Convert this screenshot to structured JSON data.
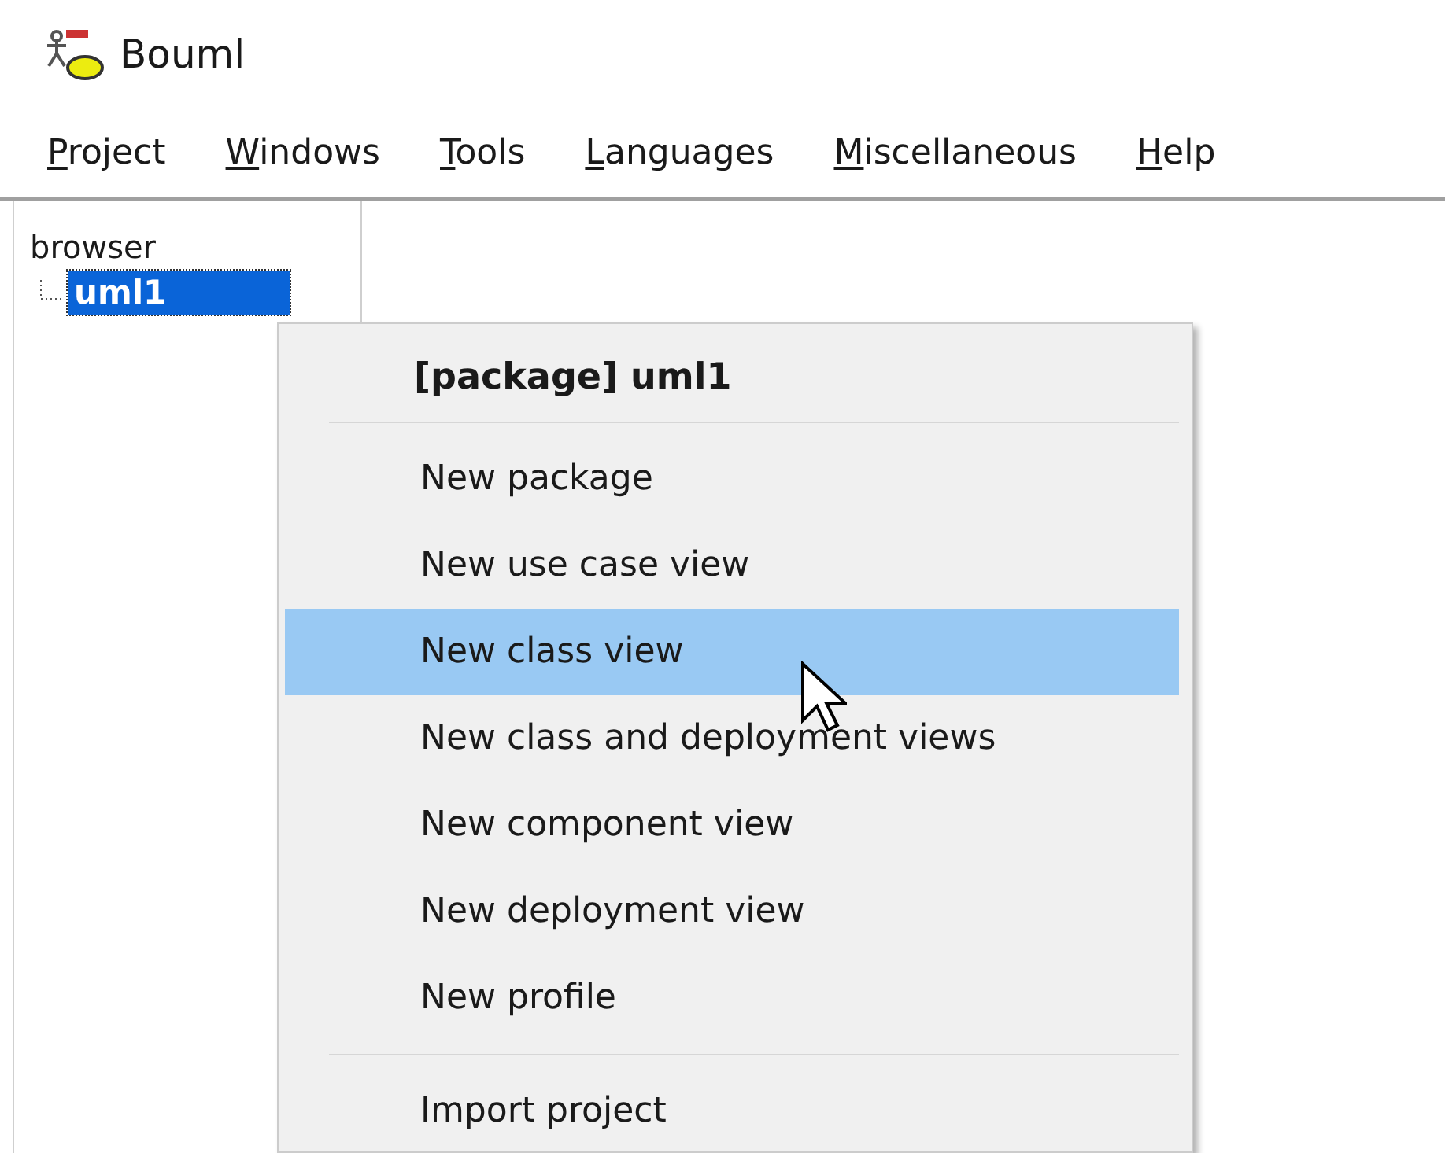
{
  "window": {
    "title": "Bouml"
  },
  "menubar": [
    {
      "label": "Project",
      "mnemonic_underlined": true
    },
    {
      "label": "Windows",
      "mnemonic_underlined": true
    },
    {
      "label": "Tools",
      "mnemonic_underlined": true
    },
    {
      "label": "Languages",
      "mnemonic_underlined": true
    },
    {
      "label": "Miscellaneous",
      "mnemonic_underlined": true
    },
    {
      "label": "Help",
      "mnemonic_underlined": true
    }
  ],
  "browser": {
    "title": "browser",
    "items": [
      {
        "label": "uml1",
        "selected": true
      }
    ]
  },
  "context_menu": {
    "items": [
      {
        "kind": "header",
        "label": "[package] uml1"
      },
      {
        "kind": "separator"
      },
      {
        "kind": "item",
        "label": "New package",
        "selected": false
      },
      {
        "kind": "item",
        "label": "New use case view",
        "selected": false
      },
      {
        "kind": "item",
        "label": "New class view",
        "selected": true
      },
      {
        "kind": "item",
        "label": "New class and deployment views",
        "selected": false
      },
      {
        "kind": "item",
        "label": "New component view",
        "selected": false
      },
      {
        "kind": "item",
        "label": "New deployment view",
        "selected": false
      },
      {
        "kind": "item",
        "label": "New profile",
        "selected": false
      },
      {
        "kind": "separator"
      },
      {
        "kind": "item",
        "label": "Import project",
        "selected": false
      }
    ]
  }
}
